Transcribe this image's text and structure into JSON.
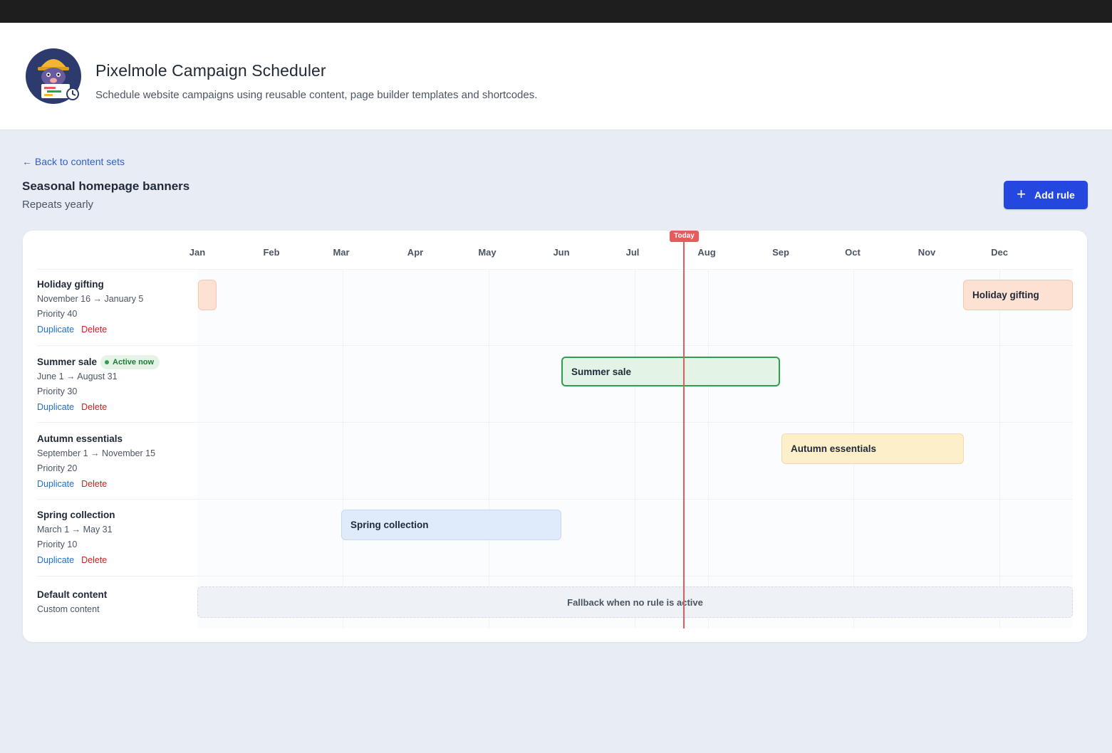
{
  "app": {
    "title": "Pixelmole Campaign Scheduler",
    "subtitle": "Schedule website campaigns using reusable content, page builder templates and shortcodes."
  },
  "nav": {
    "back_label": "← Back to content sets"
  },
  "content_set": {
    "title": "Seasonal homepage banners",
    "subtitle": "Repeats yearly"
  },
  "toolbar": {
    "add_rule_icon": "+",
    "add_rule_label": "Add rule"
  },
  "timeline": {
    "months": [
      "Jan",
      "Feb",
      "Mar",
      "Apr",
      "May",
      "Jun",
      "Jul",
      "Aug",
      "Sep",
      "Oct",
      "Nov",
      "Dec"
    ],
    "today_label": "Today"
  },
  "rules": [
    {
      "name": "Holiday gifting",
      "dates": "November 16 → January 5",
      "priority": "Priority 40",
      "bar_label": "Holiday gifting",
      "duplicate": "Duplicate",
      "delete": "Delete"
    },
    {
      "name": "Summer sale",
      "badge": "Active now",
      "dates": "June 1 → August 31",
      "priority": "Priority 30",
      "bar_label": "Summer sale",
      "duplicate": "Duplicate",
      "delete": "Delete"
    },
    {
      "name": "Autumn essentials",
      "dates": "September 1 → November 15",
      "priority": "Priority 20",
      "bar_label": "Autumn essentials",
      "duplicate": "Duplicate",
      "delete": "Delete"
    },
    {
      "name": "Spring collection",
      "dates": "March 1 → May 31",
      "priority": "Priority 10",
      "bar_label": "Spring collection",
      "duplicate": "Duplicate",
      "delete": "Delete"
    }
  ],
  "default_content": {
    "name": "Default content",
    "type": "Custom content",
    "bar_label": "Fallback when no rule is active"
  },
  "colors": {
    "accent": "#2447e0",
    "today": "#e35d5d",
    "active": "#2f9e4f",
    "holiday": "#fde1d3",
    "summer": "#e3f4e6",
    "autumn": "#fdefc9",
    "spring": "#dfeafb"
  }
}
